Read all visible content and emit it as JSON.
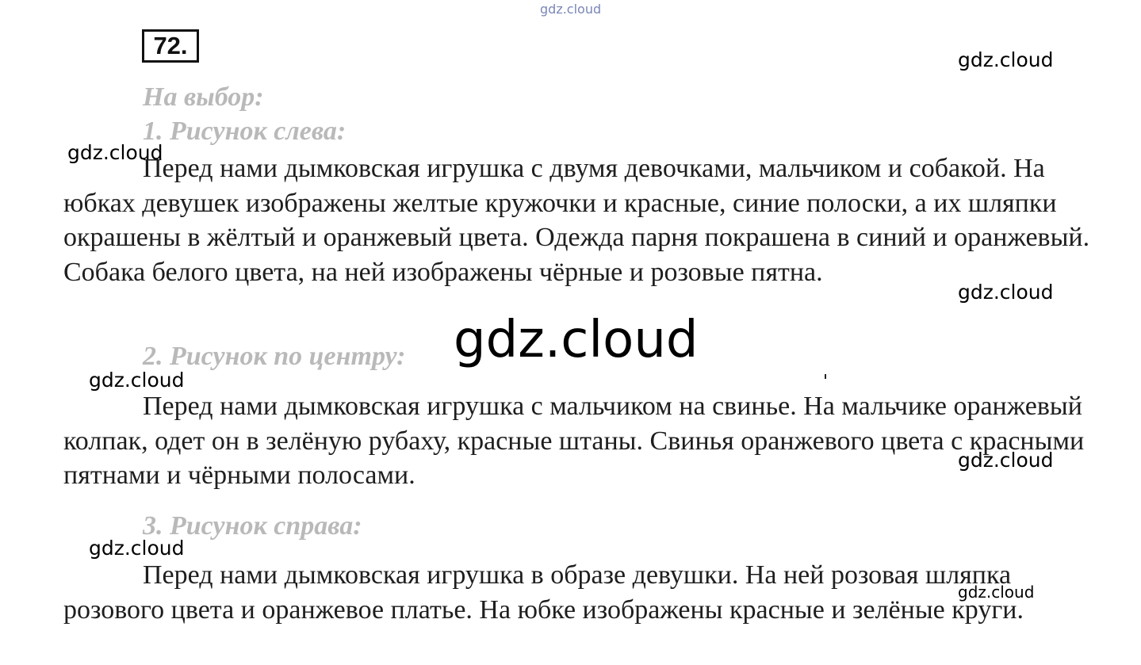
{
  "task_number": "72.",
  "choice_heading": "На выбор:",
  "sections": [
    {
      "heading": "1. Рисунок слева:",
      "text": "Перед нами дымковская игрушка с двумя девочками, мальчиком и собакой. На юбках девушек изображены желтые кружочки и красные, синие полоски, а их шляпки окрашены в жёлтый и оранжевый цвета. Одежда парня покрашена в синий и оранжевый. Собака белого цвета, на ней изображены чёрные и розовые пятна."
    },
    {
      "heading": "2. Рисунок по центру:",
      "text": "Перед нами дымковская игрушка с мальчиком на свинье. На мальчике оранжевый колпак, одет он в зелёную рубаху, красные штаны. Свинья оранжевого цвета с красными пятнами и чёрными полосами."
    },
    {
      "heading": "3. Рисунок справа:",
      "text": "Перед нами дымковская игрушка в образе девушки. На ней розовая шляпка розового цвета и оранжевое платье. На юбке изображены красные и зелёные круги."
    }
  ],
  "watermark": "gdz.cloud"
}
